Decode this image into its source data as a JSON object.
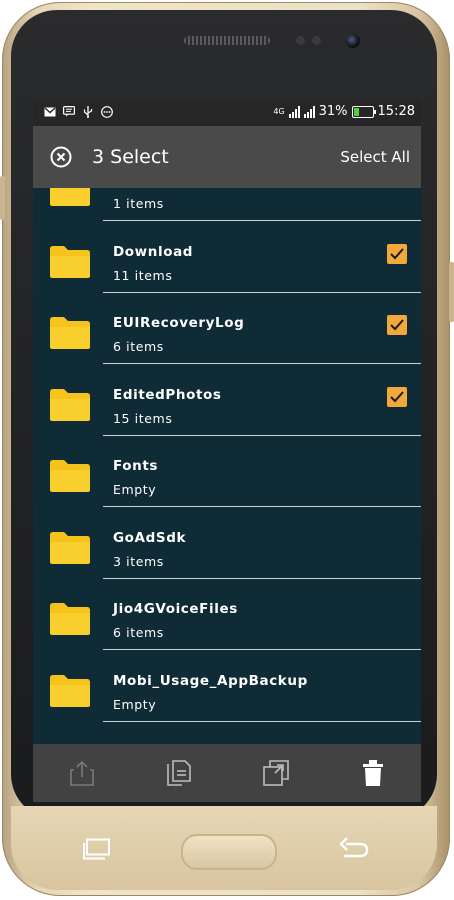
{
  "status_bar": {
    "network": "4G",
    "battery_percent_text": "31%",
    "battery_level": 0.31,
    "time": "15:28",
    "notification_icons": [
      "gmail-icon",
      "message-icon",
      "usb-icon",
      "more-icon"
    ]
  },
  "app_bar": {
    "selected_count": "3",
    "selected_label": "Select",
    "select_all_label": "Select All"
  },
  "colors": {
    "screen_background": "#0e2b36",
    "app_bar": "#4a4a4a",
    "folder": "#f6c31c",
    "checkbox": "#f2a93b"
  },
  "folders": [
    {
      "name": "",
      "count": "1 items",
      "checked": false
    },
    {
      "name": "Download",
      "count": "11 items",
      "checked": true
    },
    {
      "name": "EUIRecoveryLog",
      "count": "6 items",
      "checked": true
    },
    {
      "name": "EditedPhotos",
      "count": "15 items",
      "checked": true
    },
    {
      "name": "Fonts",
      "count": "Empty",
      "checked": false
    },
    {
      "name": "GoAdSdk",
      "count": "3 items",
      "checked": false
    },
    {
      "name": "Jio4GVoiceFiles",
      "count": "6 items",
      "checked": false
    },
    {
      "name": "Mobi_Usage_AppBackup",
      "count": "Empty",
      "checked": false
    }
  ],
  "bottom_actions": [
    "share-icon",
    "copy-icon",
    "duplicate-icon",
    "delete-icon"
  ]
}
